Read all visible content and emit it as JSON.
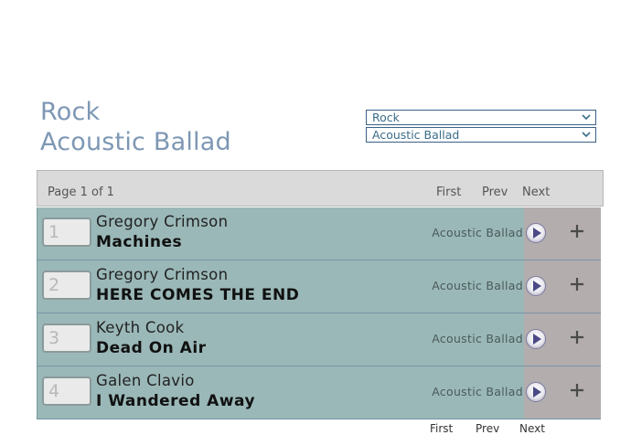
{
  "header": {
    "genre": "Rock",
    "subgenre": "Acoustic Ballad"
  },
  "filters": {
    "genre_select": "Rock",
    "subgenre_select": "Acoustic Ballad"
  },
  "pager": {
    "info": "Page 1 of 1",
    "first": "First",
    "prev": "Prev",
    "next": "Next"
  },
  "tracks": [
    {
      "number": "1",
      "artist": "Gregory Crimson",
      "title": "Machines",
      "genre": "Acoustic Ballad"
    },
    {
      "number": "2",
      "artist": "Gregory Crimson",
      "title": "HERE COMES THE END",
      "genre": "Acoustic Ballad"
    },
    {
      "number": "3",
      "artist": "Keyth Cook",
      "title": "Dead On Air",
      "genre": "Acoustic Ballad"
    },
    {
      "number": "4",
      "artist": "Galen Clavio",
      "title": "I Wandered Away",
      "genre": "Acoustic Ballad"
    }
  ],
  "icons": {
    "play": "play-icon",
    "add": "plus-icon",
    "dropdown": "chevron-down-icon"
  },
  "colors": {
    "title": "#7d97b4",
    "row_bg": "#9bb8b8",
    "action_bg": "#b3adad",
    "pager_bg": "#dadada"
  }
}
